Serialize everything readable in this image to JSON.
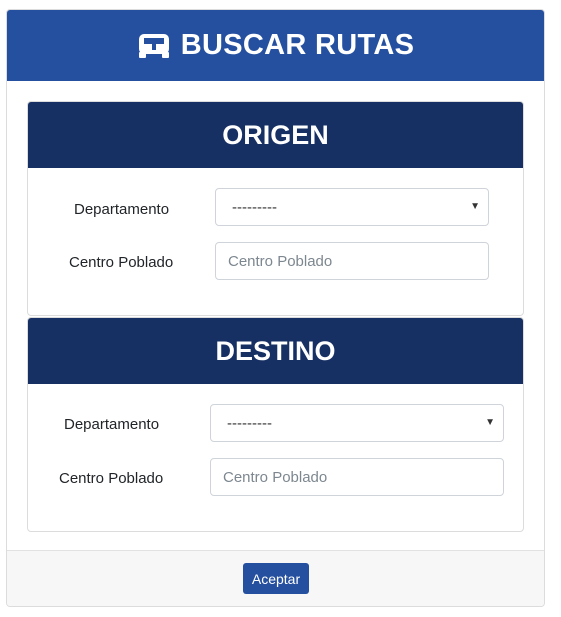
{
  "header": {
    "title": "BUSCAR RUTAS",
    "icon": "bus-icon"
  },
  "origen": {
    "title": "ORIGEN",
    "departamento_label": "Departamento",
    "departamento_value": "---------",
    "centro_label": "Centro Poblado",
    "centro_placeholder": "Centro Poblado"
  },
  "destino": {
    "title": "DESTINO",
    "departamento_label": "Departamento",
    "departamento_value": "---------",
    "centro_label": "Centro Poblado",
    "centro_placeholder": "Centro Poblado"
  },
  "footer": {
    "accept_label": "Aceptar"
  },
  "colors": {
    "header_blue": "#2550a0",
    "panel_navy": "#173063"
  }
}
